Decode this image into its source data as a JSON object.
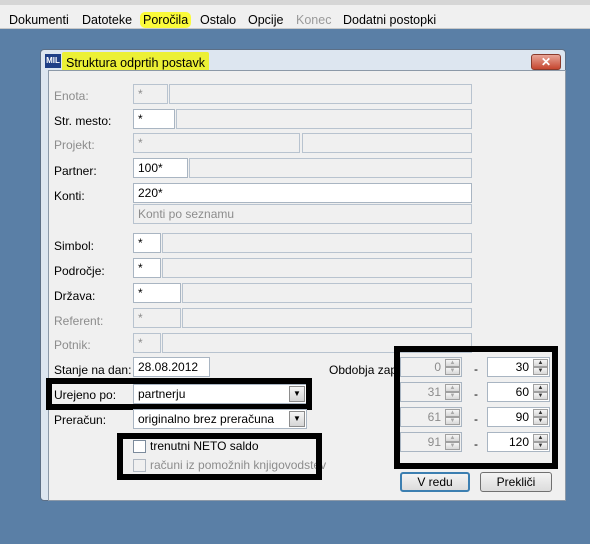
{
  "menu": {
    "items": [
      "Dokumenti",
      "Datoteke",
      "Poročila",
      "Ostalo",
      "Opcije",
      "Konec",
      "Dodatni postopki"
    ]
  },
  "dialog": {
    "title": "Struktura odprtih postavk",
    "close_label": "✕",
    "fields": {
      "enota": {
        "label": "Enota:",
        "value": "*"
      },
      "str_mesto": {
        "label": "Str. mesto:",
        "value": "*"
      },
      "projekt": {
        "label": "Projekt:",
        "value": "*"
      },
      "partner": {
        "label": "Partner:",
        "value": "100*"
      },
      "konti": {
        "label": "Konti:",
        "value": "220*",
        "description": "Konti po seznamu"
      },
      "simbol": {
        "label": "Simbol:",
        "value": "*"
      },
      "podrocje": {
        "label": "Področje:",
        "value": "*"
      },
      "drzava": {
        "label": "Država:",
        "value": "*"
      },
      "referent": {
        "label": "Referent:",
        "value": "*"
      },
      "potnik": {
        "label": "Potnik:",
        "value": "*"
      },
      "stanje_na_dan": {
        "label": "Stanje na dan:",
        "value": "28.08.2012"
      },
      "urejeno_po": {
        "label": "Urejeno po:",
        "value": "partnerju"
      },
      "preracun": {
        "label": "Preračun:",
        "value": "originalno brez preračuna"
      }
    },
    "checkboxes": {
      "neto": {
        "label": "trenutni NETO saldo",
        "checked": false
      },
      "pomozne": {
        "label": "računi iz pomožnih knjigovodstev",
        "checked": false
      }
    },
    "obdobja": {
      "label": "Obdobja zap.:",
      "separator": "-",
      "rows": [
        {
          "from": "0",
          "to": "30"
        },
        {
          "from": "31",
          "to": "60"
        },
        {
          "from": "61",
          "to": "90"
        },
        {
          "from": "91",
          "to": "120"
        }
      ]
    },
    "buttons": {
      "ok": "V redu",
      "cancel": "Prekliči"
    }
  },
  "colors": {
    "highlight": "#ecf035",
    "desktop": "#5a7fa6",
    "annotation": "#000000"
  }
}
